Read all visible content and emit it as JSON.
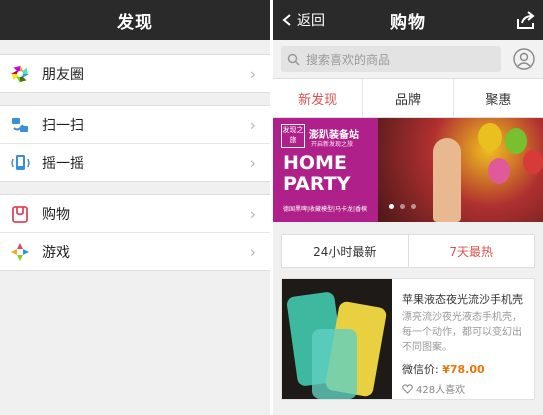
{
  "discover": {
    "title": "发现",
    "groups": [
      [
        {
          "label": "朋友圈",
          "icon": "moments-icon"
        }
      ],
      [
        {
          "label": "扫一扫",
          "icon": "scan-icon"
        },
        {
          "label": "摇一摇",
          "icon": "shake-icon"
        }
      ],
      [
        {
          "label": "购物",
          "icon": "shopping-icon"
        },
        {
          "label": "游戏",
          "icon": "games-icon"
        }
      ]
    ]
  },
  "shop": {
    "back": "返回",
    "title": "购物",
    "search_placeholder": "搜索喜欢的商品",
    "tabs": [
      "新发现",
      "品牌",
      "聚惠"
    ],
    "active_tab": 0,
    "banner": {
      "logo": "发现之旅",
      "brand": "澎趴装备站",
      "brand_sub": "开启新发现之旅",
      "headline_1": "HOME",
      "headline_2": "PARTY",
      "sub": "德国黑啤|收藏模型|马卡龙|香槟",
      "dot_count": 3,
      "active_dot": 0
    },
    "toggle": [
      "24小时最新",
      "7天最热"
    ],
    "product": {
      "title": "苹果液态夜光流沙手机壳",
      "desc": "漂亮流沙夜光液态手机壳，每一个动作，都可以变幻出不同图案。",
      "price_label": "微信价:",
      "price": "¥78.00",
      "likes": "428人喜欢"
    }
  },
  "colors": {
    "accent": "#d9534f",
    "price": "#e8760a",
    "bar": "#2a2a2a"
  }
}
